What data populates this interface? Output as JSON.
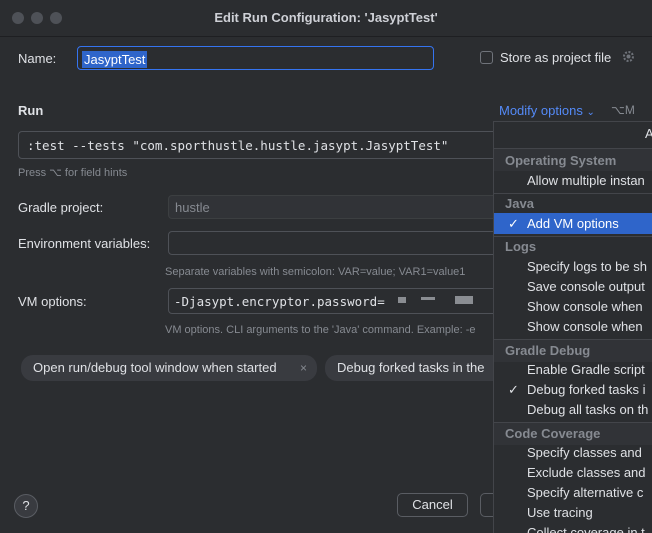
{
  "window": {
    "title": "Edit Run Configuration: 'JasyptTest'"
  },
  "name_row": {
    "label": "Name:",
    "value": "JasyptTest",
    "store_label": "Store as project file"
  },
  "run_section": {
    "label": "Run",
    "modify_options": "Modify options",
    "modify_shortcut": "⌥M",
    "command": ":test --tests \"com.sporthustle.hustle.jasypt.JasyptTest\"",
    "field_hint": "Press ⌥ for field hints"
  },
  "gradle_project": {
    "label": "Gradle project:",
    "value": "hustle"
  },
  "env_vars": {
    "label": "Environment variables:",
    "value": "",
    "hint": "Separate variables with semicolon: VAR=value; VAR1=value1"
  },
  "vm_options": {
    "label": "VM options:",
    "value": "-Djasypt.encryptor.password=",
    "hint": "VM options. CLI arguments to the 'Java' command. Example: -e"
  },
  "chips": [
    {
      "label": "Open run/debug tool window when started"
    },
    {
      "label": "Debug forked tasks in the"
    }
  ],
  "buttons": {
    "help": "?",
    "cancel": "Cancel"
  },
  "popup": {
    "header_fragment": "A",
    "groups": [
      {
        "title": "Operating System",
        "items": [
          {
            "label": "Allow multiple instan",
            "checked": false
          }
        ]
      },
      {
        "title": "Java",
        "items": [
          {
            "label": "Add VM options",
            "checked": true,
            "selected": true
          }
        ]
      },
      {
        "title": "Logs",
        "items": [
          {
            "label": "Specify logs to be sh",
            "checked": false
          },
          {
            "label": "Save console output",
            "checked": false
          },
          {
            "label": "Show console when",
            "checked": false
          },
          {
            "label": "Show console when",
            "checked": false
          }
        ]
      },
      {
        "title": "Gradle Debug",
        "items": [
          {
            "label": "Enable Gradle script",
            "checked": false
          },
          {
            "label": "Debug forked tasks i",
            "checked": true
          },
          {
            "label": "Debug all tasks on th",
            "checked": false
          }
        ]
      },
      {
        "title": "Code Coverage",
        "items": [
          {
            "label": "Specify classes and",
            "checked": false
          },
          {
            "label": "Exclude classes and",
            "checked": false
          },
          {
            "label": "Specify alternative c",
            "checked": false
          },
          {
            "label": "Use tracing",
            "checked": false
          },
          {
            "label": "Collect coverage in t",
            "checked": false
          }
        ]
      }
    ],
    "check_glyph": "✓"
  },
  "colors": {
    "background": "#2b2d30",
    "accent": "#2f65ca",
    "link": "#548af7"
  }
}
